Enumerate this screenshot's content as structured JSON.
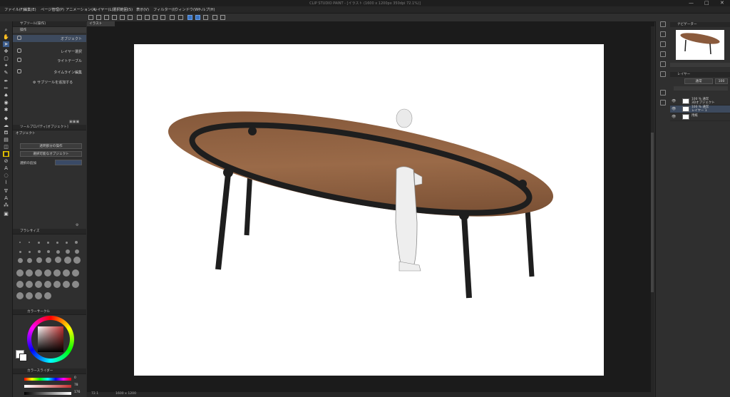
{
  "app": {
    "title": "CLIP STUDIO PAINT - [イラスト (1600 x 1200px 350dpi 72.1%)]",
    "window_controls": [
      "—",
      "□",
      "✕"
    ]
  },
  "menu": {
    "items": [
      "ファイル(F)",
      "編集(E)",
      "ページ管理(P)",
      "アニメーション(A)",
      "レイヤー(L)",
      "選択範囲(S)",
      "表示(V)",
      "フィルター(I)",
      "ウィンドウ(W)",
      "ヘルプ(H)"
    ]
  },
  "sub_tool_panel": {
    "header": "サブツール[操作]",
    "group": "操作",
    "items": [
      {
        "label": "オブジェクト",
        "icon": "arrow-icon",
        "selected": true
      },
      {
        "label": "レイヤー選択",
        "icon": "hand-select-icon",
        "selected": false
      },
      {
        "label": "ライトテーブル",
        "icon": "lighttable-icon",
        "selected": false
      },
      {
        "label": "タイムライン編集",
        "icon": "timeline-icon",
        "selected": false
      }
    ],
    "add_subtool": "サブツールを追加する"
  },
  "tool_property": {
    "header": "ツールプロパティ[オブジェクト]",
    "section": "オブジェクト",
    "fields": [
      "透明部分の操作",
      "選択可能なオブジェクト"
    ],
    "select_mode_label": "選択の追加"
  },
  "brush_size": {
    "header": "ブラシサイズ"
  },
  "color_wheel": {
    "header": "カラーサークル",
    "hue_color": "#c23030"
  },
  "color_slider": {
    "header": "カラースライダー",
    "values": [
      "0",
      "78",
      "176"
    ]
  },
  "document": {
    "tab_label": "イラスト"
  },
  "status_bar": {
    "zoom": "72.1",
    "size": "1600 x 1200"
  },
  "layers_panel": {
    "header": "レイヤー",
    "navigator_header": "ナビゲーター",
    "blend_mode": "通常",
    "opacity": "100",
    "layers": [
      {
        "name": "3Dオブジェクト",
        "sub": "100 % 通常",
        "selected": false
      },
      {
        "name": "レイヤー 1",
        "sub": "100 % 通常",
        "selected": true
      },
      {
        "name": "用紙",
        "sub": "",
        "selected": false
      }
    ]
  },
  "colors": {
    "accent": "#3b5c8c",
    "canvas_bg": "#1b1b1b",
    "paper": "#ffffff",
    "table_wood": "#8a5a3c",
    "table_frame": "#1e1e1e"
  }
}
